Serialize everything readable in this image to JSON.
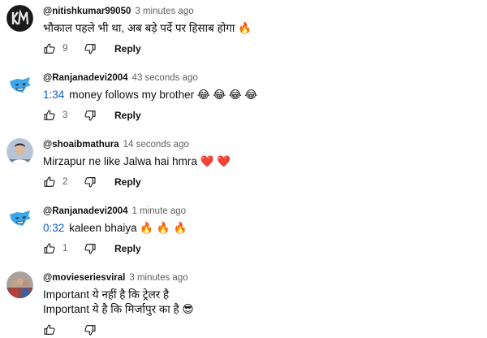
{
  "comments": [
    {
      "author": "@nitishkumar99050",
      "time": "3 minutes ago",
      "text": "भौकाल पहले भी था, अब बड़े पर्दे पर हिसाब होगा 🔥",
      "likes": "9",
      "reply_label": "Reply",
      "avatar": "km-logo-dark"
    },
    {
      "author": "@Ranjanadevi2004",
      "time": "43 seconds ago",
      "timestamp_link": "1:34",
      "text": "money follows my brother 😂 😂 😂 😂",
      "likes": "3",
      "reply_label": "Reply",
      "avatar": "beast-blue"
    },
    {
      "author": "@shoaibmathura",
      "time": "14 seconds ago",
      "text": "Mirzapur ne like Jalwa hai hmra ❤️ ❤️",
      "likes": "2",
      "reply_label": "Reply",
      "avatar": "person-photo"
    },
    {
      "author": "@Ranjanadevi2004",
      "time": "1 minute ago",
      "timestamp_link": "0:32",
      "text": "kaleen bhaiya 🔥 🔥 🔥",
      "likes": "1",
      "reply_label": "Reply",
      "avatar": "beast-blue"
    },
    {
      "author": "@movieseriesviral",
      "time": "3 minutes ago",
      "text_line1": "Important ये नहीं है कि ट्रेलर है",
      "text_line2": "Important ये है कि मिर्जापुर का है 😎",
      "avatar": "group-photo"
    }
  ],
  "colors": {
    "link": "#065fd4",
    "meta": "#606060",
    "text": "#0f0f0f"
  },
  "icons": {
    "like": "thumbs-up-icon",
    "dislike": "thumbs-down-icon"
  }
}
